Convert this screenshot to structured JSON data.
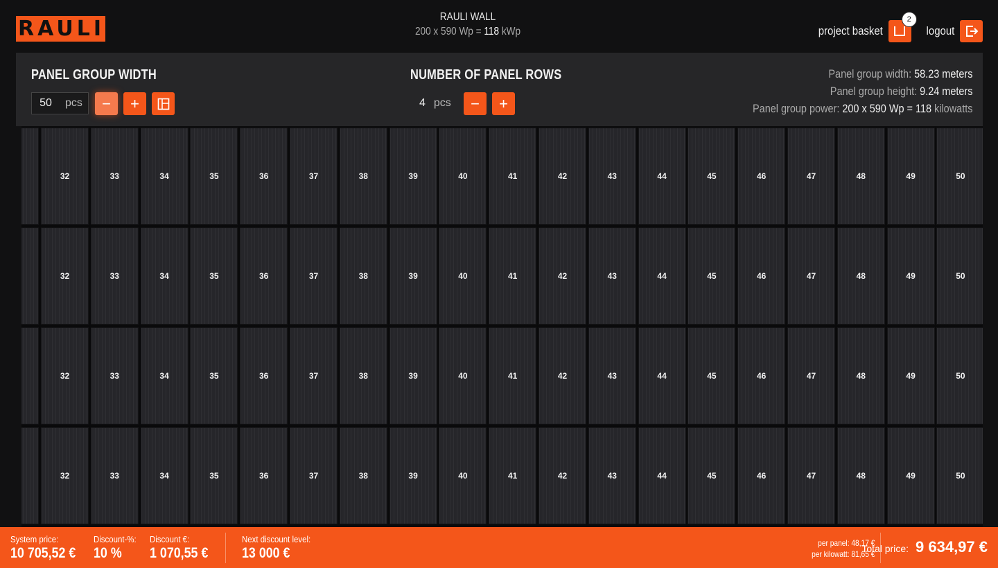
{
  "header": {
    "logo_text": "RAULI",
    "title": "RAULI WALL",
    "subtitle_prefix": "200 x 590 Wp = ",
    "subtitle_value": "118",
    "subtitle_unit": " kWp",
    "project_basket_label": "project basket",
    "basket_count": "2",
    "logout_label": "logout"
  },
  "controls": {
    "width_title": "PANEL GROUP WIDTH",
    "width_value": "50",
    "width_unit": "pcs",
    "rows_title": "NUMBER OF PANEL ROWS",
    "rows_value": "4",
    "rows_unit": "pcs",
    "minus": "−",
    "plus": "+"
  },
  "info": {
    "width_label": "Panel group width: ",
    "width_value": "58.23 meters",
    "height_label": "Panel group height: ",
    "height_value": "9.24 meters",
    "power_label": "Panel group power: ",
    "power_value": "200 x 590 Wp = 118",
    "power_unit": " kilowatts"
  },
  "grid": {
    "rows": 4,
    "panel_numbers": [
      "32",
      "33",
      "34",
      "35",
      "36",
      "37",
      "38",
      "39",
      "40",
      "41",
      "42",
      "43",
      "44",
      "45",
      "46",
      "47",
      "48",
      "49",
      "50"
    ]
  },
  "footer": {
    "system_price_label": "System price:",
    "system_price_value": "10 705,52 €",
    "discount_pct_label": "Discount-%:",
    "discount_pct_value": "10 %",
    "discount_eur_label": "Discount €:",
    "discount_eur_value": "1 070,55 €",
    "next_level_label": "Next discount level:",
    "next_level_value": "13 000 €",
    "per_panel": "per panel: 48,17 €",
    "per_kilowatt": "per kilowatt: 81,65 €",
    "total_label": "Total price:",
    "total_value": "9 634,97 €"
  },
  "colors": {
    "accent": "#f4561a",
    "background": "#111112",
    "panel": "#26262a",
    "controls_bg": "#262628"
  }
}
